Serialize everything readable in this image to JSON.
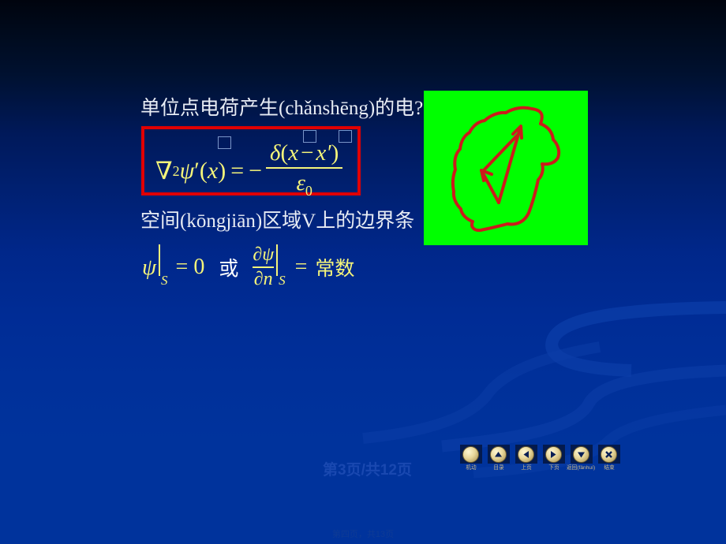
{
  "slide": {
    "background_top_color": "#00040e",
    "background_bottom_color": "#00339c",
    "accent_yellow": "#f5f57a",
    "box_red": "#e00000",
    "picture_green": "#00ff00"
  },
  "content": {
    "title_line": "单位点电荷产生(chǎnshēng)的电?",
    "space_line": "空间(kōngjiān)区域V上的边界条",
    "formula": {
      "nabla": "∇",
      "nabla_power": "2",
      "psi": "ψ",
      "prime": "′",
      "open_paren": "(",
      "var_x": "x",
      "close_paren": ")",
      "equals": "=",
      "minus": "−",
      "numerator_delta": "δ",
      "numerator_open": "(",
      "numerator_x": "x",
      "numerator_minus": "−",
      "numerator_xprime": "x′",
      "numerator_close": ")",
      "denominator_eps": "ε",
      "denominator_sub": "0",
      "full_text": "∇²ψ′(x) = − δ(x − x′) / ε₀"
    },
    "boundary_condition": {
      "psi": "ψ",
      "sub_s": "S",
      "equals": "=",
      "zero": "0",
      "or_word": "或",
      "partial_num": "∂ψ",
      "partial_den": "∂n",
      "sub_s2": "S",
      "equals2": "=",
      "constant_word": "常数",
      "full_text": "ψ|S = 0  或  ∂ψ/∂n|S = 常数"
    }
  },
  "picture": {
    "alt_name": "green-diagram-with-red-blob-and-arrows",
    "fill_color": "#00ff00",
    "stroke_color": "#cc1b1b"
  },
  "footer": {
    "page_indicator": "第3页/共12页",
    "bottom_note": "第四页，共13页"
  },
  "navigation": {
    "items": [
      {
        "label": "机动",
        "icon": "circle-plain-icon"
      },
      {
        "label": "目录",
        "icon": "triangle-up-icon"
      },
      {
        "label": "上页",
        "icon": "triangle-left-icon"
      },
      {
        "label": "下页",
        "icon": "triangle-right-icon"
      },
      {
        "label": "返回(fǎnhuí)",
        "icon": "triangle-down-icon"
      },
      {
        "label": "结束",
        "icon": "close-x-icon"
      }
    ]
  }
}
